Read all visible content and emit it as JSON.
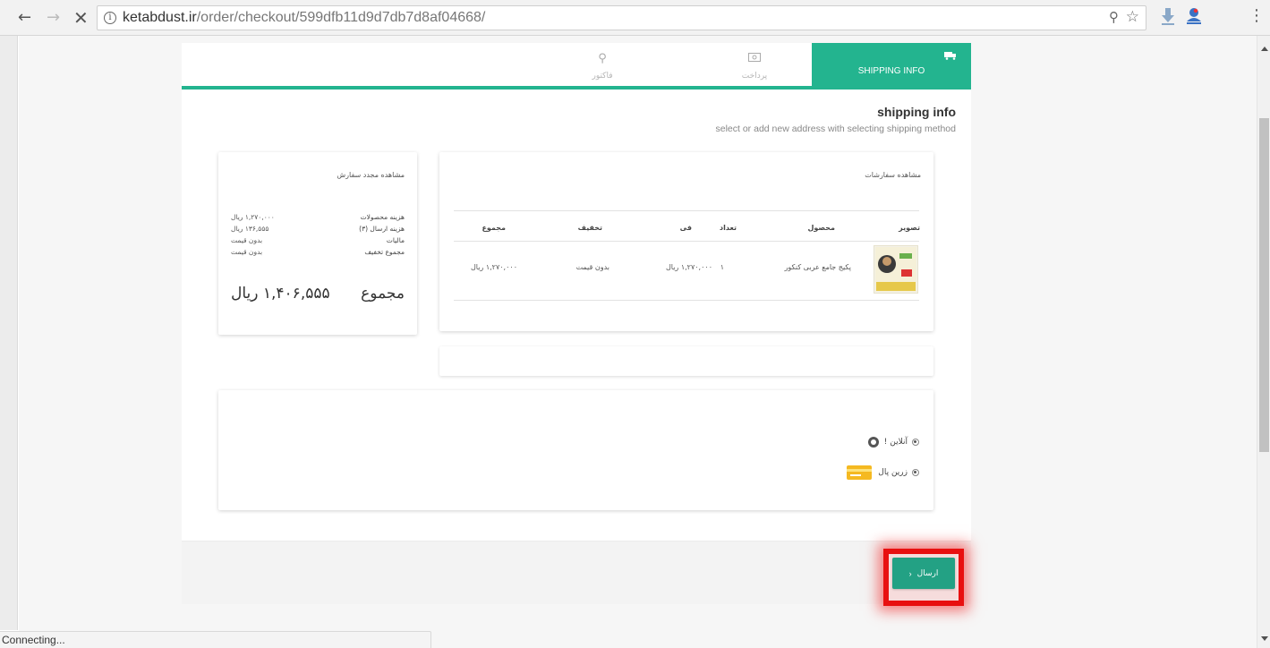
{
  "browser": {
    "url_host": "ketabdust.ir",
    "url_path": "/order/checkout/599dfb11d9d7db7d8af04668/",
    "status": "Connecting..."
  },
  "steps": {
    "invoice": "فاکتور",
    "payment": "پرداخت",
    "shipping": "SHIPPING INFO"
  },
  "header": {
    "title": "shipping info",
    "subtitle": "select or add new address with selecting shipping method"
  },
  "summary": {
    "title": "مشاهده مجدد سفارش",
    "rows": [
      {
        "label": "هزینه محصولات",
        "value": "۱,۲۷۰,۰۰۰ ریال"
      },
      {
        "label": "هزینه ارسال (۳)",
        "value": "۱۳۶,۵۵۵ ریال"
      },
      {
        "label": "مالیات",
        "value": "بدون قیمت"
      },
      {
        "label": "مجموع تخفیف",
        "value": "بدون قیمت"
      }
    ],
    "total_label": "مجموع",
    "total_value": "۱,۴۰۶,۵۵۵ ریال"
  },
  "orders": {
    "title": "مشاهده سفارشات",
    "columns": [
      "تصویر",
      "محصول",
      "تعداد",
      "فی",
      "تخفیف",
      "مجموع"
    ],
    "rows": [
      {
        "product": "پکیج جامع عربی کنکور",
        "qty": "۱",
        "price": "۱,۲۷۰,۰۰۰ ریال",
        "discount": "بدون قیمت",
        "total": "۱,۲۷۰,۰۰۰ ریال"
      }
    ]
  },
  "payment": {
    "options": [
      {
        "label": "آنلاین !"
      },
      {
        "label": "زرین پال"
      }
    ]
  },
  "footer": {
    "submit_label": "ارسال"
  },
  "colors": {
    "accent": "#23b48f",
    "button": "#23a184",
    "highlight": "#e81010"
  }
}
